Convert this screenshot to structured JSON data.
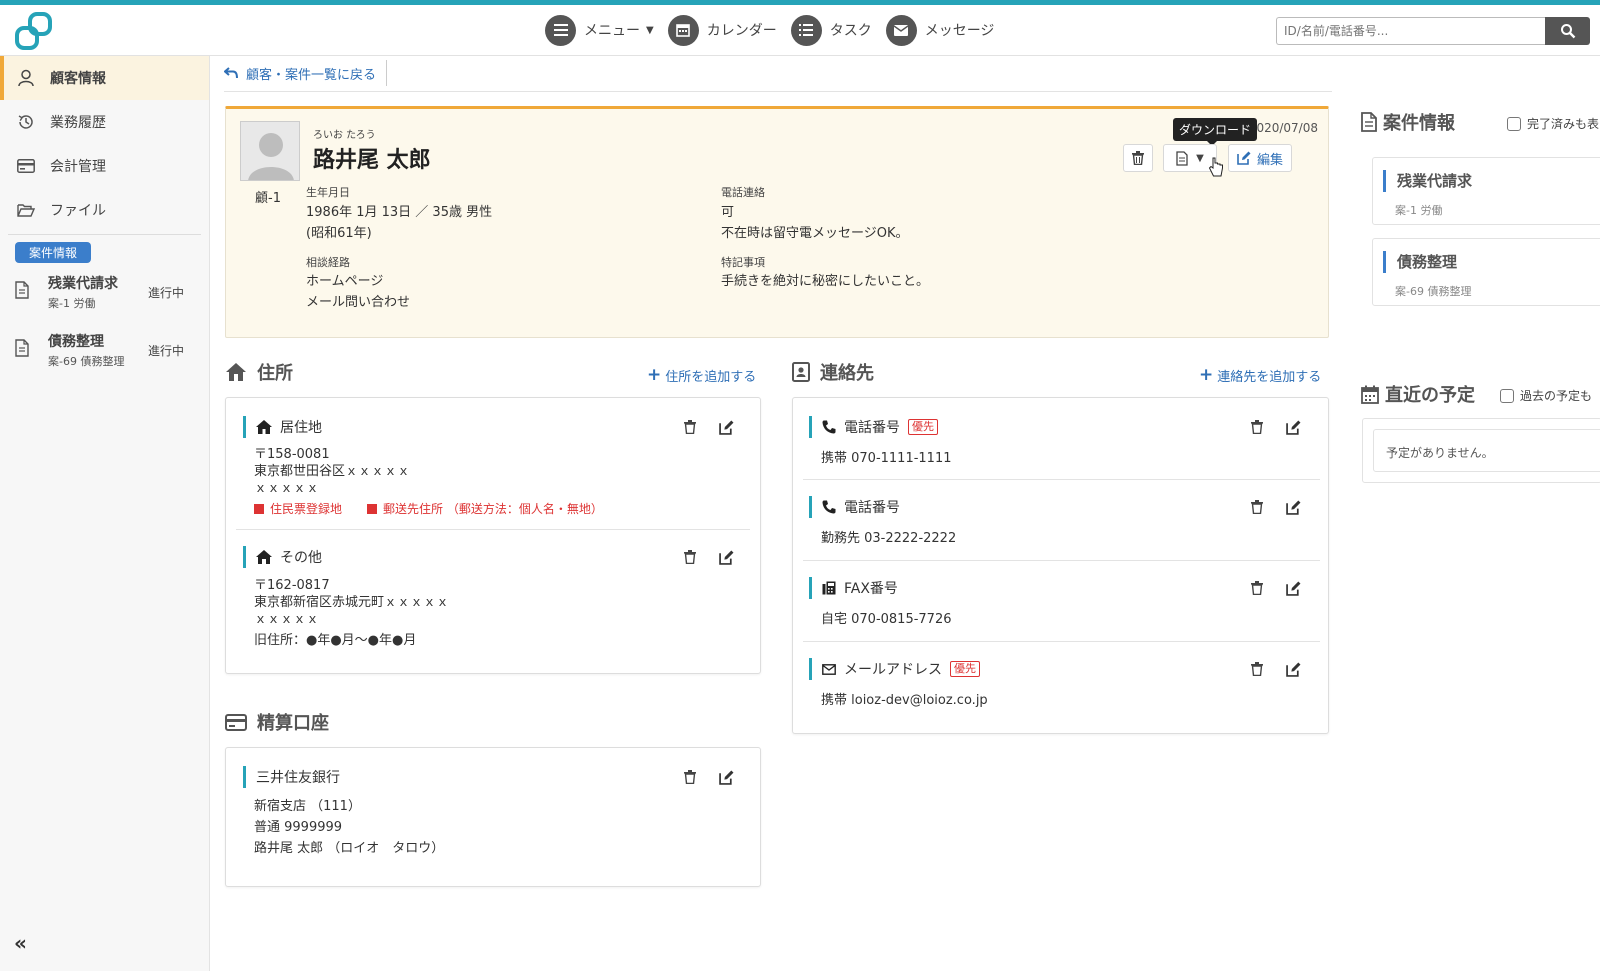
{
  "header": {
    "nav": [
      {
        "label": "メニュー",
        "icon": "menu-icon"
      },
      {
        "label": "カレンダー",
        "icon": "calendar-icon"
      },
      {
        "label": "タスク",
        "icon": "task-list-icon"
      },
      {
        "label": "メッセージ",
        "icon": "envelope-icon"
      }
    ],
    "search_placeholder": "ID/名前/電話番号..."
  },
  "sidebar": {
    "items": [
      {
        "label": "顧客情報",
        "active": true
      },
      {
        "label": "業務履歴"
      },
      {
        "label": "会計管理"
      },
      {
        "label": "ファイル"
      }
    ],
    "badge": "案件情報",
    "cases": [
      {
        "name": "残業代請求",
        "sub": "案-1 労働",
        "status": "進行中"
      },
      {
        "name": "債務整理",
        "sub": "案-69 債務整理",
        "status": "進行中"
      }
    ]
  },
  "breadcrumb": {
    "back_label": "顧客・案件一覧に戻る"
  },
  "profile": {
    "kana": "ろいお たろう",
    "name": "路井尾 太郎",
    "customer_id": "顧-1",
    "date": "020/07/08",
    "tooltip": "ダウンロード",
    "edit_label": "編集",
    "birth_label": "生年月日",
    "birth_line1": "1986年 1月 13日 ／ 35歳 男性",
    "birth_line2": "(昭和61年)",
    "phone_contact_label": "電話連絡",
    "phone_contact_line1": "可",
    "phone_contact_line2": "不在時は留守電メッセージOK。",
    "route_label": "相談経路",
    "route_line1": "ホームページ",
    "route_line2": "メール問い合わせ",
    "notes_label": "特記事項",
    "notes_line1": "手続きを絶対に秘密にしたいこと。"
  },
  "address": {
    "title": "住所",
    "add_label": "住所を追加する",
    "entries": [
      {
        "type": "居住地",
        "postal": "〒158-0081",
        "line1": "東京都世田谷区ｘｘｘｘｘ",
        "line2": "ｘｘｘｘｘ",
        "note1": "住民票登録地",
        "note2": "郵送先住所 （郵送方法：個人名・無地）"
      },
      {
        "type": "その他",
        "postal": "〒162-0817",
        "line1": "東京都新宿区赤城元町ｘｘｘｘｘ",
        "line2": "ｘｘｘｘｘ",
        "line3": "旧住所：●年●月～●年●月"
      }
    ]
  },
  "account": {
    "title": "精算口座",
    "bank": "三井住友銀行",
    "branch": "新宿支店 （111）",
    "number": "普通 9999999",
    "holder": "路井尾 太郎 （ロイオ　タロウ）"
  },
  "contacts": {
    "title": "連絡先",
    "add_label": "連絡先を追加する",
    "priority_label": "優先",
    "entries": [
      {
        "type": "電話番号",
        "value": "携帯 070-1111-1111",
        "priority": true
      },
      {
        "type": "電話番号",
        "value": "勤務先 03-2222-2222"
      },
      {
        "type": "FAX番号",
        "value": "自宅 070-0815-7726"
      },
      {
        "type": "メールアドレス",
        "value": "携帯 loioz-dev@loioz.co.jp",
        "priority": true
      }
    ]
  },
  "right": {
    "cases_title": "案件情報",
    "cases_checkbox": "完了済みも表",
    "cases": [
      {
        "name": "残業代請求",
        "sub": "案-1 労働"
      },
      {
        "name": "債務整理",
        "sub": "案-69 債務整理"
      }
    ],
    "schedule_title": "直近の予定",
    "schedule_checkbox": "過去の予定も",
    "schedule_empty": "予定がありません。"
  },
  "colors": {
    "accent": "#26a3b8",
    "brand_orange": "#f0a838",
    "link": "#2f6fb6",
    "priority_red": "#dd3333"
  }
}
